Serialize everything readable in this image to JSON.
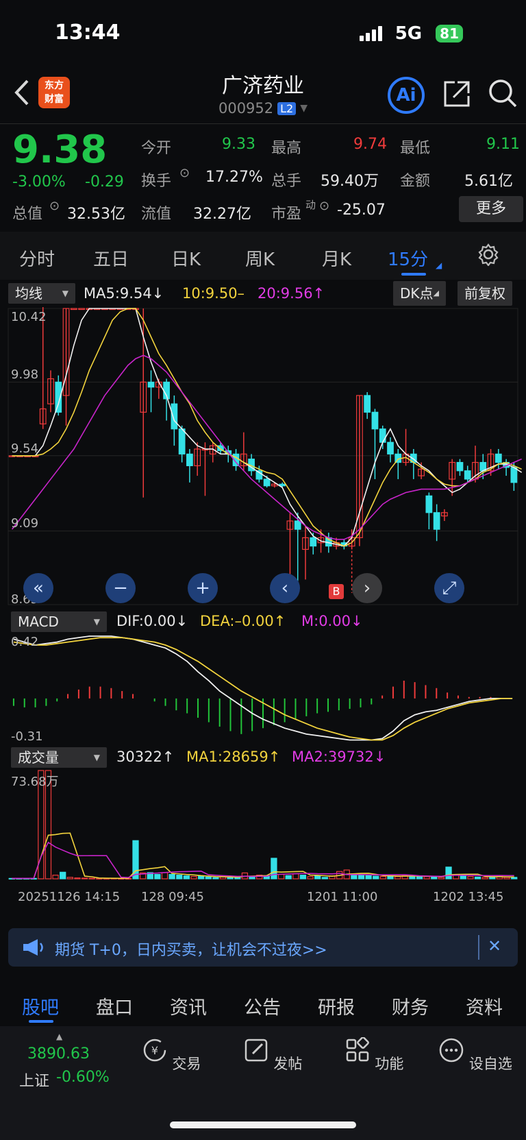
{
  "status_bar": {
    "time": "13:44",
    "network": "5G",
    "battery": "81"
  },
  "header": {
    "logo_text_1": "东方",
    "logo_text_2": "财富",
    "stock_name": "广济药业",
    "stock_code": "000952",
    "badge": "L2",
    "ai_label": "Ai"
  },
  "quote": {
    "price": "9.38",
    "change_pct": "-3.00%",
    "change": "-0.29",
    "open_label": "今开",
    "open": "9.33",
    "high_label": "最高",
    "high": "9.74",
    "low_label": "最低",
    "low": "9.11",
    "turnover_label": "换手",
    "turnover": "17.27%",
    "volume_label": "总手",
    "volume": "59.40万",
    "amount_label": "金额",
    "amount": "5.61亿",
    "mktcap_label": "总值",
    "mktcap": "32.53亿",
    "float_label": "流值",
    "float": "32.27亿",
    "pe_label": "市盈",
    "pe_sup": "动",
    "pe": "-25.07",
    "more_label": "更多"
  },
  "period_tabs": [
    "分时",
    "五日",
    "日K",
    "周K",
    "月K",
    "15分"
  ],
  "active_period": "15分",
  "kline_toolbar": {
    "ma_dropdown": "均线",
    "ma5": "MA5:9.54↓",
    "ma10": "10:9.50–",
    "ma20": "20:9.56↑",
    "dk_button": "DK点",
    "adjust_button": "前复权"
  },
  "macd_toolbar": {
    "dropdown": "MACD",
    "dif": "DIF:0.00↓",
    "dea": "DEA:–0.00↑",
    "m": "M:0.00↓"
  },
  "volume_toolbar": {
    "dropdown": "成交量",
    "vol": "30322↑",
    "ma1": "MA1:28659↑",
    "ma2": "MA2:39732↓"
  },
  "colors": {
    "up": "#ef3b3b",
    "down": "#34e0e6",
    "ma5": "#f0f0f0",
    "ma10": "#f2d33d",
    "ma20": "#c724c9",
    "accent": "#2f7bff"
  },
  "chart_data": [
    {
      "type": "candlestick",
      "title": "",
      "y_tick_labels": [
        "10.42",
        "9.98",
        "9.54",
        "9.09",
        "8.65"
      ],
      "ylim": [
        8.65,
        10.42
      ],
      "buy_marker": "B",
      "candles": [
        {
          "o": 9.54,
          "c": 9.54,
          "h": 9.54,
          "l": 9.54
        },
        {
          "o": 9.54,
          "c": 9.54,
          "h": 9.54,
          "l": 9.54
        },
        {
          "o": 9.54,
          "c": 9.54,
          "h": 9.54,
          "l": 9.54
        },
        {
          "o": 9.54,
          "c": 9.54,
          "h": 9.54,
          "l": 9.54
        },
        {
          "o": 9.73,
          "c": 9.82,
          "h": 10.45,
          "l": 9.7
        },
        {
          "o": 9.85,
          "c": 10.0,
          "h": 10.05,
          "l": 9.8
        },
        {
          "o": 9.98,
          "c": 9.8,
          "h": 10.02,
          "l": 9.78
        },
        {
          "o": 9.9,
          "c": 10.42,
          "h": 10.42,
          "l": 9.72
        },
        {
          "o": 10.42,
          "c": 10.42,
          "h": 10.42,
          "l": 10.42
        },
        {
          "o": 10.42,
          "c": 10.42,
          "h": 10.42,
          "l": 10.42
        },
        {
          "o": 10.42,
          "c": 10.42,
          "h": 10.42,
          "l": 10.42
        },
        {
          "o": 10.42,
          "c": 10.42,
          "h": 10.42,
          "l": 10.42
        },
        {
          "o": 10.42,
          "c": 10.42,
          "h": 10.42,
          "l": 10.42
        },
        {
          "o": 10.42,
          "c": 10.42,
          "h": 10.42,
          "l": 10.42
        },
        {
          "o": 10.42,
          "c": 10.42,
          "h": 10.42,
          "l": 10.42
        },
        {
          "o": 10.42,
          "c": 10.42,
          "h": 10.42,
          "l": 10.42
        },
        {
          "o": 10.42,
          "c": 10.42,
          "h": 10.42,
          "l": 10.42
        },
        {
          "o": 9.8,
          "c": 9.98,
          "h": 10.42,
          "l": 9.29
        },
        {
          "o": 9.98,
          "c": 9.95,
          "h": 10.05,
          "l": 9.8
        },
        {
          "o": 9.95,
          "c": 9.98,
          "h": 10.0,
          "l": 9.88
        },
        {
          "o": 9.98,
          "c": 9.88,
          "h": 10.0,
          "l": 9.75
        },
        {
          "o": 9.85,
          "c": 9.7,
          "h": 9.9,
          "l": 9.6
        },
        {
          "o": 9.7,
          "c": 9.55,
          "h": 9.72,
          "l": 9.5
        },
        {
          "o": 9.55,
          "c": 9.48,
          "h": 9.58,
          "l": 9.38
        },
        {
          "o": 9.48,
          "c": 9.58,
          "h": 9.62,
          "l": 9.42
        },
        {
          "o": 9.58,
          "c": 9.58,
          "h": 9.62,
          "l": 9.3
        },
        {
          "o": 9.55,
          "c": 9.6,
          "h": 9.62,
          "l": 9.5
        },
        {
          "o": 9.6,
          "c": 9.57,
          "h": 9.62,
          "l": 9.55
        },
        {
          "o": 9.57,
          "c": 9.55,
          "h": 9.6,
          "l": 9.5
        },
        {
          "o": 9.55,
          "c": 9.48,
          "h": 9.58,
          "l": 9.45
        },
        {
          "o": 9.48,
          "c": 9.55,
          "h": 9.68,
          "l": 9.45
        },
        {
          "o": 9.52,
          "c": 9.45,
          "h": 9.55,
          "l": 9.42
        },
        {
          "o": 9.45,
          "c": 9.4,
          "h": 9.48,
          "l": 9.38
        },
        {
          "o": 9.4,
          "c": 9.36,
          "h": 9.42,
          "l": 9.35
        },
        {
          "o": 9.36,
          "c": 9.37,
          "h": 9.38,
          "l": 9.35
        },
        {
          "o": 9.37,
          "c": 9.36,
          "h": 9.38,
          "l": 9.35
        },
        {
          "o": 9.1,
          "c": 9.15,
          "h": 9.2,
          "l": 8.68
        },
        {
          "o": 9.15,
          "c": 9.1,
          "h": 9.2,
          "l": 8.78
        },
        {
          "o": 8.98,
          "c": 9.05,
          "h": 9.12,
          "l": 8.8
        },
        {
          "o": 9.05,
          "c": 9.0,
          "h": 9.08,
          "l": 8.95
        },
        {
          "o": 9.02,
          "c": 9.05,
          "h": 9.1,
          "l": 8.96
        },
        {
          "o": 9.05,
          "c": 9.0,
          "h": 9.08,
          "l": 8.96
        },
        {
          "o": 9.0,
          "c": 9.02,
          "h": 9.05,
          "l": 8.98
        },
        {
          "o": 9.02,
          "c": 9.0,
          "h": 9.04,
          "l": 8.98
        },
        {
          "o": 9.0,
          "c": 9.05,
          "h": 9.1,
          "l": 8.98
        },
        {
          "o": 9.05,
          "c": 9.9,
          "h": 9.9,
          "l": 9.0
        },
        {
          "o": 9.9,
          "c": 9.8,
          "h": 9.92,
          "l": 9.76
        },
        {
          "o": 9.8,
          "c": 9.7,
          "h": 9.82,
          "l": 9.4
        },
        {
          "o": 9.7,
          "c": 9.62,
          "h": 9.72,
          "l": 9.58
        },
        {
          "o": 9.62,
          "c": 9.55,
          "h": 9.65,
          "l": 9.5
        },
        {
          "o": 9.55,
          "c": 9.5,
          "h": 9.58,
          "l": 9.4
        },
        {
          "o": 9.5,
          "c": 9.55,
          "h": 9.7,
          "l": 9.48
        },
        {
          "o": 9.55,
          "c": 9.5,
          "h": 9.58,
          "l": 9.4
        },
        {
          "o": 9.42,
          "c": 9.46,
          "h": 9.5,
          "l": 9.4
        },
        {
          "o": 9.3,
          "c": 9.2,
          "h": 9.32,
          "l": 9.1
        },
        {
          "o": 9.2,
          "c": 9.1,
          "h": 9.25,
          "l": 9.03
        },
        {
          "o": 9.18,
          "c": 9.2,
          "h": 9.22,
          "l": 9.15
        },
        {
          "o": 9.4,
          "c": 9.5,
          "h": 9.52,
          "l": 9.3
        },
        {
          "o": 9.5,
          "c": 9.45,
          "h": 9.52,
          "l": 9.42
        },
        {
          "o": 9.45,
          "c": 9.4,
          "h": 9.48,
          "l": 9.38
        },
        {
          "o": 9.4,
          "c": 9.5,
          "h": 9.6,
          "l": 9.38
        },
        {
          "o": 9.5,
          "c": 9.45,
          "h": 9.55,
          "l": 9.4
        },
        {
          "o": 9.45,
          "c": 9.55,
          "h": 9.58,
          "l": 9.42
        },
        {
          "o": 9.55,
          "c": 9.5,
          "h": 9.58,
          "l": 9.46
        },
        {
          "o": 9.5,
          "c": 9.47,
          "h": 9.52,
          "l": 9.42
        },
        {
          "o": 9.47,
          "c": 9.38,
          "h": 9.5,
          "l": 9.33
        }
      ],
      "ma5": [
        9.54,
        9.54,
        9.54,
        9.54,
        9.6,
        9.72,
        9.85,
        10.02,
        10.2,
        10.35,
        10.42,
        10.42,
        10.42,
        10.42,
        10.42,
        10.42,
        10.42,
        10.25,
        10.1,
        9.98,
        9.9,
        9.75,
        9.7,
        9.65,
        9.6,
        9.58,
        9.58,
        9.55,
        9.55,
        9.53,
        9.5,
        9.47,
        9.44,
        9.41,
        9.38,
        9.35,
        9.25,
        9.18,
        9.12,
        9.06,
        9.03,
        9.02,
        9.01,
        9.0,
        9.05,
        9.2,
        9.35,
        9.5,
        9.62,
        9.7,
        9.6,
        9.55,
        9.52,
        9.48,
        9.45,
        9.4,
        9.36,
        9.32,
        9.34,
        9.38,
        9.42,
        9.45,
        9.47,
        9.49,
        9.49,
        9.47,
        9.44
      ],
      "ma10": [
        9.54,
        9.54,
        9.54,
        9.54,
        9.55,
        9.58,
        9.62,
        9.7,
        9.8,
        9.92,
        10.05,
        10.15,
        10.25,
        10.35,
        10.4,
        10.42,
        10.42,
        10.35,
        10.25,
        10.15,
        10.08,
        10.0,
        9.92,
        9.85,
        9.75,
        9.68,
        9.62,
        9.58,
        9.55,
        9.53,
        9.5,
        9.48,
        9.46,
        9.44,
        9.43,
        9.4,
        9.33,
        9.26,
        9.19,
        9.12,
        9.08,
        9.04,
        9.02,
        9.0,
        9.02,
        9.08,
        9.18,
        9.28,
        9.38,
        9.46,
        9.52,
        9.53,
        9.5,
        9.47,
        9.44,
        9.4,
        9.37,
        9.36,
        9.36,
        9.38,
        9.4,
        9.44,
        9.46,
        9.49,
        9.5,
        9.48,
        9.46
      ],
      "ma20": [
        9.1,
        9.16,
        9.22,
        9.28,
        9.34,
        9.4,
        9.46,
        9.52,
        9.58,
        9.66,
        9.74,
        9.82,
        9.9,
        9.96,
        10.02,
        10.08,
        10.12,
        10.14,
        10.12,
        10.08,
        10.04,
        9.98,
        9.92,
        9.86,
        9.8,
        9.74,
        9.68,
        9.62,
        9.56,
        9.5,
        9.45,
        9.4,
        9.36,
        9.32,
        9.28,
        9.24,
        9.2,
        9.16,
        9.12,
        9.09,
        9.07,
        9.05,
        9.04,
        9.04,
        9.06,
        9.1,
        9.15,
        9.2,
        9.25,
        9.28,
        9.3,
        9.32,
        9.33,
        9.34,
        9.34,
        9.34,
        9.34,
        9.35,
        9.36,
        9.38,
        9.4,
        9.42,
        9.44,
        9.46,
        9.48,
        9.5,
        9.52
      ]
    },
    {
      "type": "bar",
      "title": "",
      "y_tick_labels": [
        "0.42",
        "-0.31"
      ],
      "ylim": [
        -0.31,
        0.42
      ],
      "dif": [
        0.4,
        0.38,
        0.36,
        0.37,
        0.38,
        0.4,
        0.41,
        0.42,
        0.42,
        0.42,
        0.41,
        0.4,
        0.38,
        0.36,
        0.34,
        0.3,
        0.25,
        0.18,
        0.12,
        0.05,
        0.0,
        -0.05,
        -0.1,
        -0.14,
        -0.17,
        -0.2,
        -0.22,
        -0.24,
        -0.25,
        -0.26,
        -0.27,
        -0.28,
        -0.28,
        -0.28,
        -0.27,
        -0.22,
        -0.15,
        -0.11,
        -0.09,
        -0.08,
        -0.06,
        -0.04,
        -0.02,
        -0.01,
        0.0,
        0.0,
        0.0
      ],
      "dea": [
        0.38,
        0.37,
        0.36,
        0.36,
        0.37,
        0.38,
        0.39,
        0.4,
        0.41,
        0.41,
        0.41,
        0.4,
        0.39,
        0.38,
        0.36,
        0.33,
        0.29,
        0.25,
        0.2,
        0.15,
        0.1,
        0.05,
        0.01,
        -0.03,
        -0.07,
        -0.11,
        -0.14,
        -0.17,
        -0.2,
        -0.22,
        -0.24,
        -0.26,
        -0.27,
        -0.28,
        -0.28,
        -0.25,
        -0.2,
        -0.16,
        -0.13,
        -0.1,
        -0.07,
        -0.05,
        -0.03,
        -0.02,
        -0.01,
        -0.0,
        -0.0
      ],
      "histogram": [
        -0.05,
        -0.06,
        -0.06,
        -0.05,
        -0.02,
        0.03,
        0.06,
        0.08,
        0.08,
        0.07,
        0.05,
        0.03,
        0.0,
        -0.02,
        -0.05,
        -0.08,
        -0.1,
        -0.13,
        -0.16,
        -0.19,
        -0.22,
        -0.24,
        -0.22,
        -0.2,
        -0.18,
        -0.16,
        -0.14,
        -0.12,
        -0.1,
        -0.09,
        -0.08,
        -0.07,
        -0.06,
        -0.04,
        0.02,
        0.08,
        0.12,
        0.11,
        0.09,
        0.07,
        0.04,
        0.02,
        0.01,
        0.01,
        0.01,
        0.0,
        0.0
      ]
    },
    {
      "type": "bar",
      "title": "",
      "y_tick_labels": [
        "73.68万"
      ],
      "x_tick_labels": [
        "20251126 14:15",
        "128 09:45",
        "1201 11:00",
        "1202 13:45"
      ],
      "values": [
        0.3,
        0.3,
        0.3,
        0.3,
        73.7,
        73.7,
        2.5,
        4.5,
        1.0,
        0.6,
        0.5,
        0.4,
        0.3,
        0.3,
        0.4,
        0.3,
        0.3,
        26.0,
        4.0,
        4.2,
        3.0,
        4.2,
        3.0,
        2.5,
        2.0,
        1.6,
        1.8,
        1.2,
        0.8,
        1.5,
        1.2,
        1.0,
        4.0,
        1.5,
        2.5,
        2.0,
        14.0,
        3.0,
        2.2,
        3.5,
        2.5,
        1.5,
        2.0,
        1.0,
        2.0,
        5.0,
        6.0,
        3.0,
        2.5,
        2.2,
        1.8,
        1.6,
        2.0,
        1.5,
        2.2,
        2.0,
        1.8,
        1.5,
        1.2,
        1.0,
        8.0,
        3.0,
        2.0,
        1.5,
        1.2,
        1.0,
        1.5,
        2.0,
        1.0,
        1.0
      ],
      "up_flags": [
        0,
        0,
        0,
        0,
        1,
        1,
        1,
        0,
        1,
        1,
        1,
        1,
        1,
        1,
        1,
        1,
        1,
        0,
        1,
        0,
        0,
        1,
        0,
        0,
        0,
        1,
        0,
        0,
        0,
        1,
        0,
        0,
        1,
        0,
        1,
        0,
        0,
        1,
        0,
        1,
        0,
        1,
        0,
        0,
        1,
        1,
        1,
        0,
        0,
        0,
        0,
        1,
        0,
        1,
        1,
        0,
        0,
        1,
        0,
        1,
        0,
        1,
        0,
        1,
        0,
        1,
        0,
        1,
        1,
        0
      ]
    }
  ],
  "banner": {
    "text": "期货 T+0，日内买卖，让机会不过夜>>"
  },
  "bottom_tabs": [
    "股吧",
    "盘口",
    "资讯",
    "公告",
    "研报",
    "财务",
    "资料"
  ],
  "bottom_bar": {
    "index_value": "3890.63",
    "index_name": "上证",
    "index_pct": "-0.60%",
    "trade": "交易",
    "post": "发帖",
    "function": "功能",
    "watchlist": "设自选"
  }
}
